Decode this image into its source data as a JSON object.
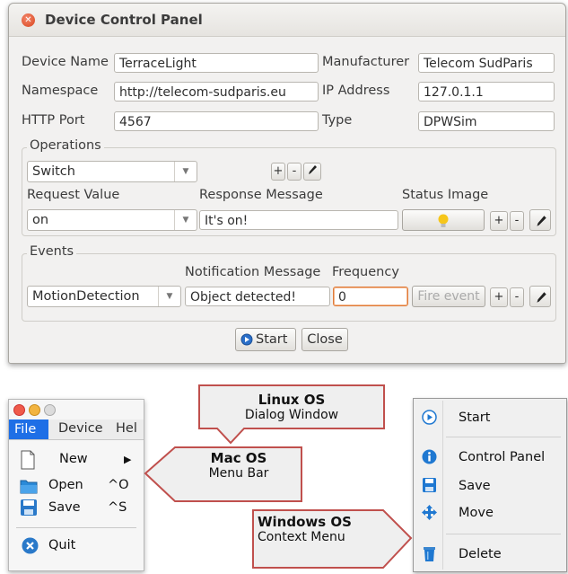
{
  "dialog": {
    "title": "Device Control Panel",
    "labels": {
      "device_name": "Device Name",
      "manufacturer": "Manufacturer",
      "namespace": "Namespace",
      "ip_address": "IP Address",
      "http_port": "HTTP Port",
      "type": "Type"
    },
    "values": {
      "device_name": "TerraceLight",
      "manufacturer": "Telecom SudParis",
      "namespace": "http://telecom-sudparis.eu",
      "ip_address": "127.0.1.1",
      "http_port": "4567",
      "type": "DPWSim"
    },
    "operations": {
      "title": "Operations",
      "selected": "Switch",
      "request_value_label": "Request Value",
      "response_message_label": "Response Message",
      "status_image_label": "Status Image",
      "request_value": "on",
      "response_message": "It's on!"
    },
    "events": {
      "title": "Events",
      "notification_label": "Notification Message",
      "frequency_label": "Frequency",
      "selected": "MotionDetection",
      "notification_message": "Object detected!",
      "frequency": "0",
      "fire_event": "Fire event"
    },
    "small_buttons": {
      "plus": "+",
      "minus": "-"
    },
    "start": "Start",
    "close": "Close"
  },
  "mac": {
    "menus": [
      "File",
      "Device",
      "Hel"
    ],
    "items": [
      {
        "label": "New",
        "shortcut": "▶"
      },
      {
        "label": "Open",
        "shortcut": "^O"
      },
      {
        "label": "Save",
        "shortcut": "^S"
      },
      {
        "label": "Quit",
        "shortcut": ""
      }
    ]
  },
  "callouts": {
    "linux": {
      "title": "Linux OS",
      "sub": "Dialog Window"
    },
    "mac": {
      "title": "Mac OS",
      "sub": "Menu Bar"
    },
    "windows": {
      "title": "Windows OS",
      "sub": "Context Menu"
    }
  },
  "windows_menu": {
    "items": [
      "Start",
      "Control Panel",
      "Save",
      "Move",
      "Delete"
    ]
  },
  "colors": {
    "accent_orange": "#e07b39",
    "callout_border": "#c0504d",
    "mac_selection": "#1e6fe6",
    "win_blue": "#1f78d1"
  }
}
